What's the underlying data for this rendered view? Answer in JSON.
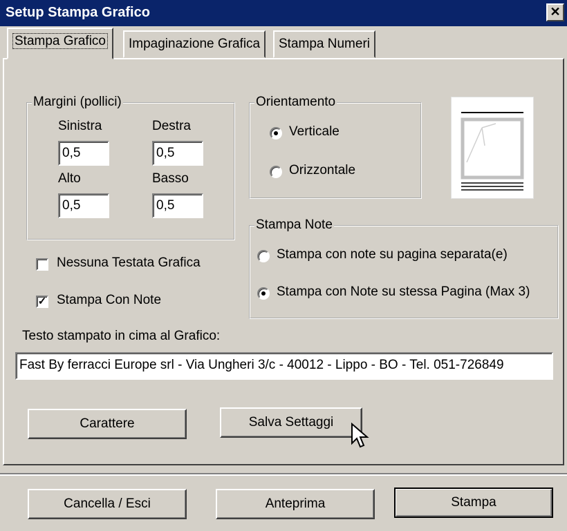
{
  "window": {
    "title": "Setup Stampa Grafico",
    "close_label": "✕"
  },
  "tabs": [
    "Stampa Grafico",
    "Impaginazione Grafica",
    "Stampa Numeri"
  ],
  "margins": {
    "legend": "Margini (pollici)",
    "left_label": "Sinistra",
    "left_value": "0,5",
    "right_label": "Destra",
    "right_value": "0,5",
    "top_label": "Alto",
    "top_value": "0,5",
    "bottom_label": "Basso",
    "bottom_value": "0,5"
  },
  "orientation": {
    "legend": "Orientamento",
    "options": [
      "Verticale",
      "Orizzontale"
    ],
    "selected": "Verticale"
  },
  "notes": {
    "legend": "Stampa Note",
    "options": [
      "Stampa con note su pagina separata(e)",
      "Stampa con Note su stessa Pagina (Max 3)"
    ],
    "selected": "Stampa con Note su stessa Pagina (Max 3)"
  },
  "checkboxes": {
    "no_header_label": "Nessuna Testata Grafica",
    "no_header_checked": false,
    "print_notes_label": "Stampa Con Note",
    "print_notes_checked": true
  },
  "header_text": {
    "label": "Testo stampato in cima al Grafico:",
    "value": "Fast By ferracci Europe srl - Via Ungheri 3/c - 40012 - Lippo - BO - Tel. 051-726849"
  },
  "buttons": {
    "font": "Carattere",
    "save_settings": "Salva Settaggi",
    "cancel_exit": "Cancella / Esci",
    "preview": "Anteprima",
    "print": "Stampa"
  }
}
